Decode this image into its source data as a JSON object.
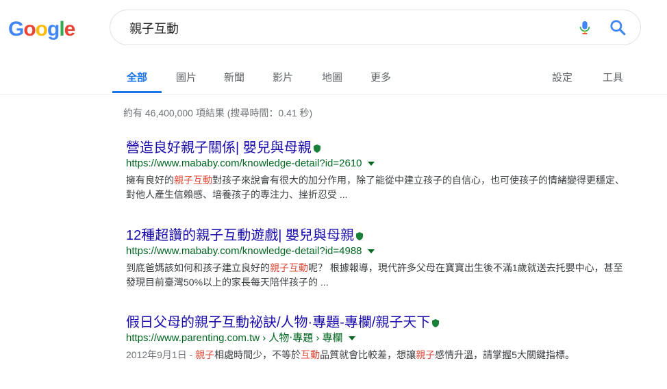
{
  "logo": {
    "letters": [
      "G",
      "o",
      "o",
      "g",
      "l",
      "e"
    ],
    "colors": [
      "#4285f4",
      "#ea4335",
      "#fbbc05",
      "#4285f4",
      "#34a853",
      "#ea4335"
    ]
  },
  "search": {
    "query": "親子互動"
  },
  "icons": {
    "mic": "mic-icon",
    "search": "search-icon",
    "verified": "shield-icon"
  },
  "tabs": [
    {
      "label": "全部",
      "active": true
    },
    {
      "label": "圖片"
    },
    {
      "label": "新聞"
    },
    {
      "label": "影片"
    },
    {
      "label": "地圖"
    },
    {
      "label": "更多"
    }
  ],
  "tools": {
    "settings": "設定",
    "tools": "工具"
  },
  "stats": "約有 46,400,000 項結果 (搜尋時間：0.41 秒)",
  "results": [
    {
      "title": "營造良好親子關係| 嬰兒與母親",
      "url": "https://www.mababy.com/knowledge-detail?id=2610",
      "snippet": {
        "p1": "擁有良好的",
        "h1": "親子互動",
        "p2": "對孩子來說會有很大的加分作用，除了能從中建立孩子的自信心，也可使孩子的情緒變得更穩定、對他人產生信賴感、培養孩子的專注力、挫折忍受 ..."
      }
    },
    {
      "title": "12種超讚的親子互動遊戲| 嬰兒與母親",
      "url": "https://www.mababy.com/knowledge-detail?id=4988",
      "snippet": {
        "p1": "到底爸媽該如何和孩子建立良好的",
        "h1": "親子互動",
        "p2": "呢？ 根據報導，現代許多父母在寶寶出生後不滿1歲就送去托嬰中心，甚至發現目前臺灣50%以上的家長每天陪伴孩子的 ..."
      }
    },
    {
      "title": "假日父母的親子互動祕訣/人物·專題-專欄/親子天下",
      "url": "https://www.parenting.com.tw",
      "breadcrumb": "› 人物‧專題 › 專欄",
      "snippet": {
        "date": "2012年9月1日 - ",
        "h1": "親子",
        "p1": "相處時間少，不等於",
        "h2": "互動",
        "p2": "品質就會比較差，想讓",
        "h3": "親子",
        "p3": "感情升溫，請掌握5大關鍵指標。"
      }
    }
  ]
}
